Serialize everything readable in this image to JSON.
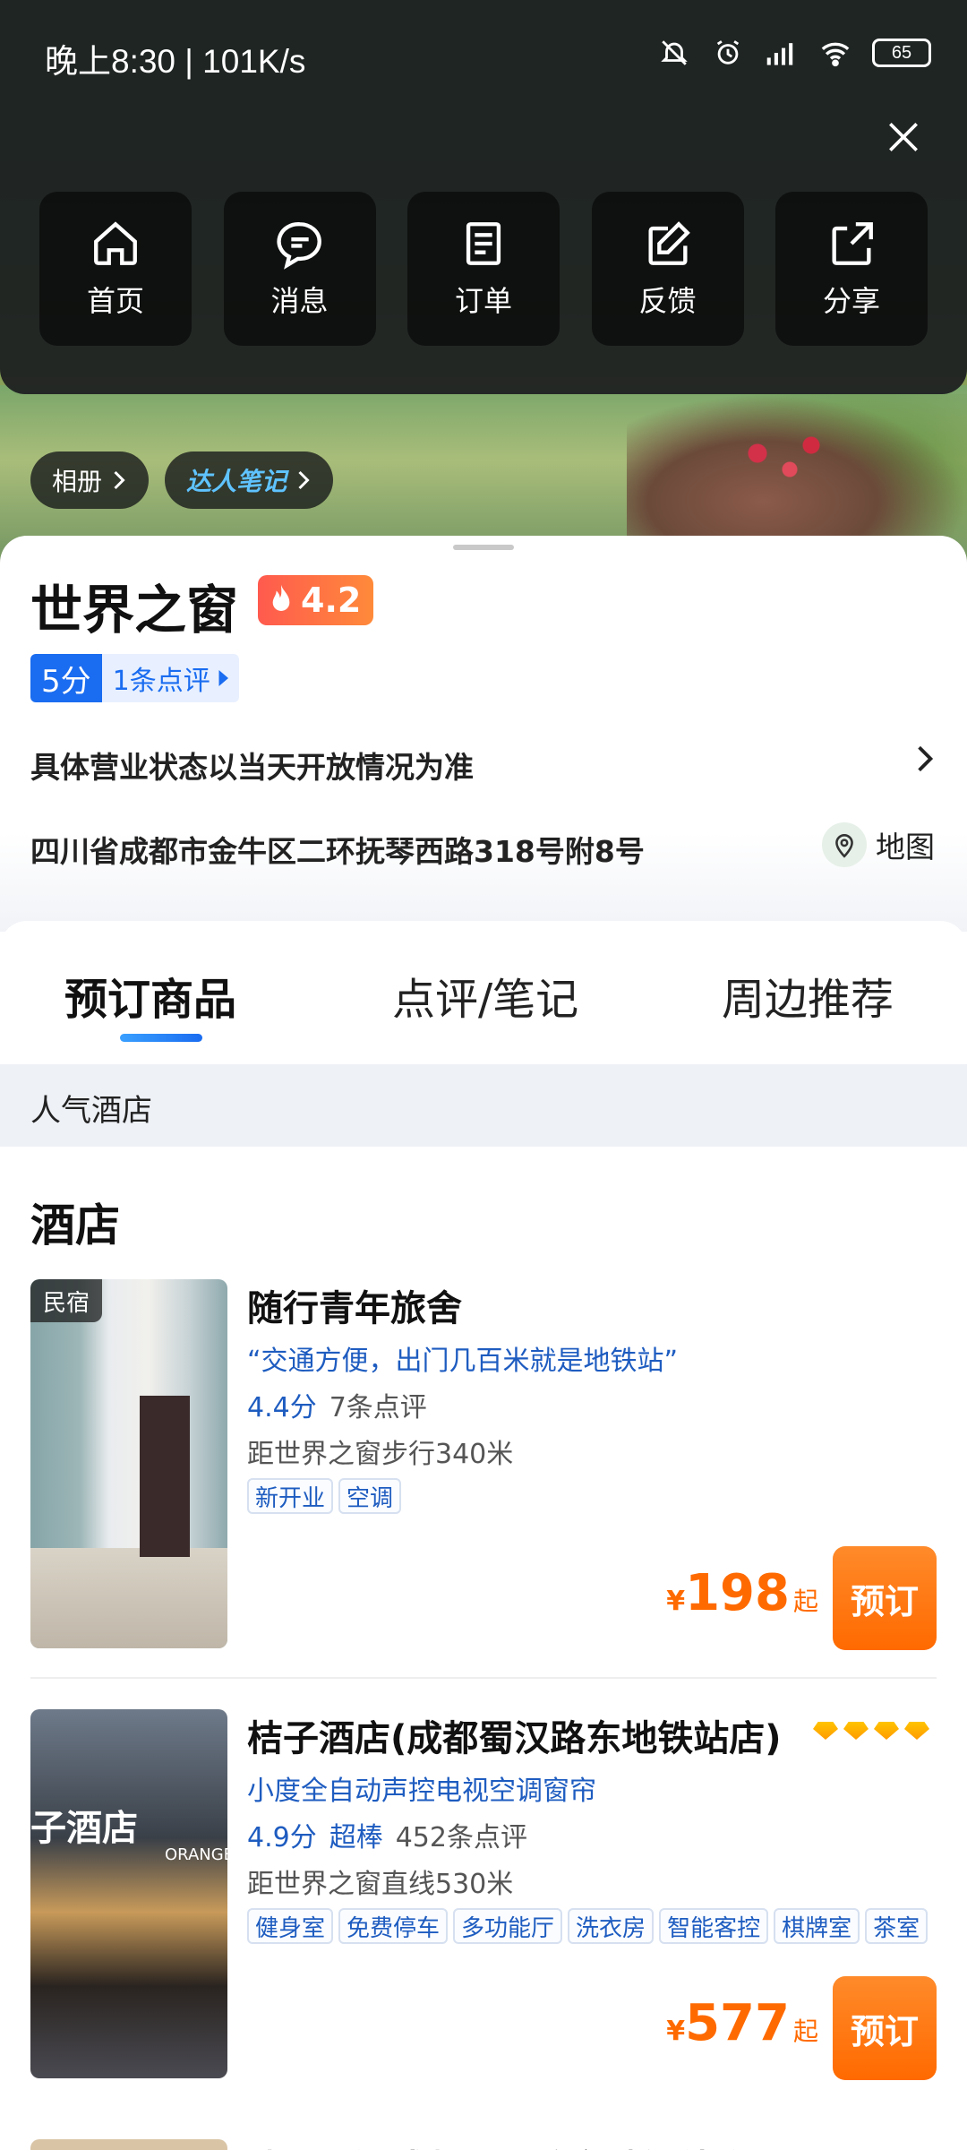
{
  "status_bar": {
    "time": "晚上8:30 | 101K/s",
    "battery": "65"
  },
  "quick_actions": [
    {
      "label": "首页",
      "icon": "home-icon"
    },
    {
      "label": "消息",
      "icon": "message-icon"
    },
    {
      "label": "订单",
      "icon": "order-icon"
    },
    {
      "label": "反馈",
      "icon": "feedback-icon"
    },
    {
      "label": "分享",
      "icon": "share-icon"
    }
  ],
  "hero": {
    "album_label": "相册",
    "notes_label": "达人笔记"
  },
  "poi": {
    "title": "世界之窗",
    "heat_score": "4.2",
    "rating_score": "5分",
    "review_count": "1条点评",
    "open_status": "具体营业状态以当天开放情况为准",
    "address": "四川省成都市金牛区二环抚琴西路318号附8号",
    "map_label": "地图"
  },
  "tabs": [
    "预订商品",
    "点评/笔记",
    "周边推荐"
  ],
  "section_label": "人气酒店",
  "hotel_heading": "酒店",
  "hotels": [
    {
      "thumb_tag": "民宿",
      "name": "随行青年旅舍",
      "quote": "“交通方便，出门几百米就是地铁站”",
      "score": "4.4分",
      "grade": "",
      "reviews": "7条点评",
      "distance": "距世界之窗步行340米",
      "tags": [
        "新开业",
        "空调"
      ],
      "price_symbol": "¥",
      "price": "198",
      "price_suffix": "起",
      "book_label": "预订"
    },
    {
      "thumb_tag": "",
      "thumb_sign": "子酒店",
      "thumb_sign2": "ORANGE",
      "name": "桔子酒店(成都蜀汉路东地铁站店)",
      "quote": "小度全自动声控电视空调窗帘",
      "score": "4.9分",
      "grade": "超棒",
      "reviews": "452条点评",
      "distance": "距世界之窗直线530米",
      "tags": [
        "健身室",
        "免费停车",
        "多功能厅",
        "洗衣房",
        "智能客控",
        "棋牌室",
        "茶室"
      ],
      "price_symbol": "¥",
      "price": "577",
      "price_suffix": "起",
      "book_label": "预订"
    }
  ],
  "peek_hotel_name": "涑?酒店(成都黑汉路东地铁站店)",
  "colors": {
    "accent_blue": "#1a6cf0",
    "price_orange": "#ff6a00",
    "heat_red": "#ff5a4e"
  }
}
